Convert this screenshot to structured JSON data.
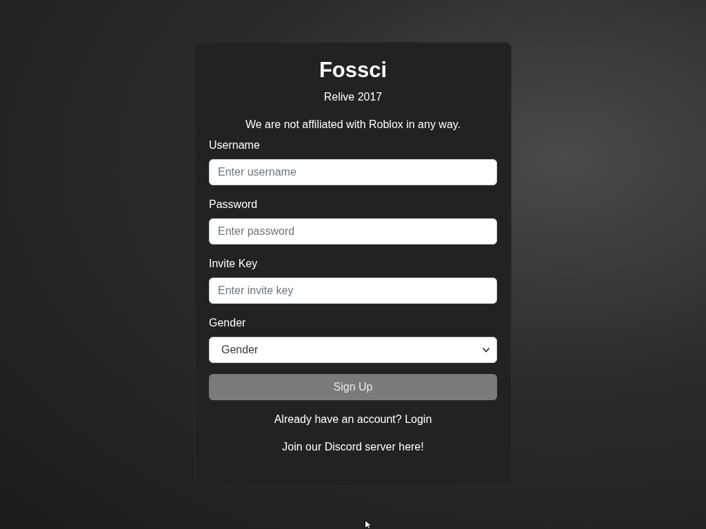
{
  "header": {
    "title": "Fossci",
    "tagline": "Relive 2017",
    "disclaimer": "We are not affiliated with Roblox in any way."
  },
  "form": {
    "fields": [
      {
        "kind": "text",
        "label": "Username",
        "placeholder": "Enter username"
      },
      {
        "kind": "password",
        "label": "Password",
        "placeholder": "Enter password"
      },
      {
        "kind": "text",
        "label": "Invite Key",
        "placeholder": "Enter invite key"
      },
      {
        "kind": "select",
        "label": "Gender",
        "value": "Gender"
      }
    ],
    "submit": "Sign Up"
  },
  "login_prompt": {
    "text": "Already have an account?",
    "link": "Login"
  },
  "discord_link": "Join our Discord server here!"
}
